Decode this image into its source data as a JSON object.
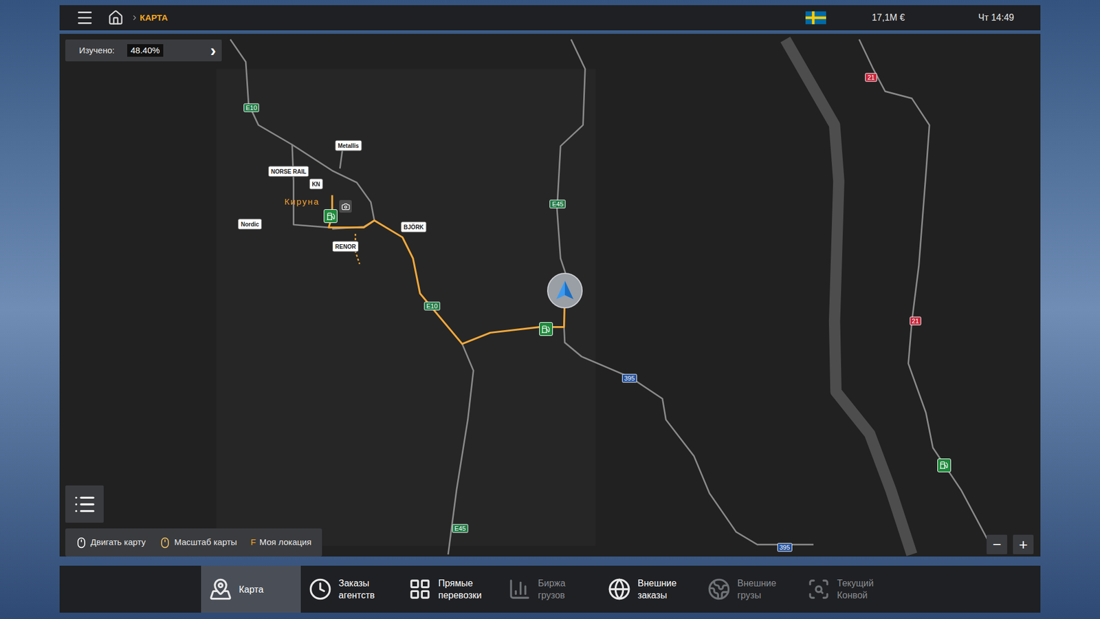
{
  "top_bar": {
    "breadcrumb": "КАРТА",
    "money": "17,1M €",
    "time": "Чт 14:49"
  },
  "explored": {
    "label": "Изучено:",
    "value": "48.40%",
    "arrow": "›"
  },
  "map": {
    "city": "Кируна",
    "road_signs": [
      {
        "label": "E10",
        "color": "#1d7a43"
      },
      {
        "label": "E45",
        "color": "#1d7a43"
      },
      {
        "label": "E10",
        "color": "#1d7a43"
      },
      {
        "label": "395",
        "color": "#1f4e9c"
      },
      {
        "label": "E45",
        "color": "#1d7a43"
      },
      {
        "label": "395",
        "color": "#1f4e9c"
      },
      {
        "label": "21",
        "color": "#c8243a"
      },
      {
        "label": "21",
        "color": "#c8243a"
      }
    ],
    "companies": [
      {
        "name": "Metallis"
      },
      {
        "name": "NORSE RAIL"
      },
      {
        "name": "KN"
      },
      {
        "name": "BJÖRK"
      },
      {
        "name": "RENOR"
      },
      {
        "name": "Nordic"
      }
    ]
  },
  "hints": [
    {
      "kind": "mouse",
      "key": "",
      "label": "Двигать карту"
    },
    {
      "kind": "wheel",
      "key": "",
      "label": "Масштаб карты"
    },
    {
      "kind": "key",
      "key": "F",
      "label": "Моя локация"
    }
  ],
  "zoom": {
    "out": "−",
    "in": "+"
  },
  "nav": [
    {
      "lines": [
        "Карта"
      ],
      "selected": true,
      "disabled": false
    },
    {
      "lines": [
        "Заказы",
        "агентств"
      ],
      "selected": false,
      "disabled": false
    },
    {
      "lines": [
        "Прямые",
        "перевозки"
      ],
      "selected": false,
      "disabled": false
    },
    {
      "lines": [
        "Биржа",
        "грузов"
      ],
      "selected": false,
      "disabled": true
    },
    {
      "lines": [
        "Внешние",
        "заказы"
      ],
      "selected": false,
      "disabled": false
    },
    {
      "lines": [
        "Внешние",
        "грузы"
      ],
      "selected": false,
      "disabled": true
    },
    {
      "lines": [
        "Текущий",
        "Конвой"
      ],
      "selected": false,
      "disabled": true
    }
  ]
}
